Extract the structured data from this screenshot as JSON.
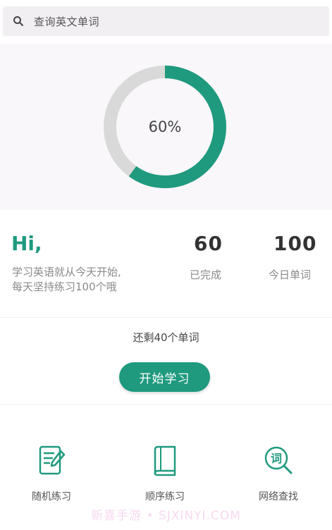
{
  "search": {
    "placeholder": "查询英文单词",
    "icon": "search-icon"
  },
  "progress": {
    "percent_label": "60%",
    "value": 0.6,
    "track_color": "#d9d9d9",
    "fill_color": "#1f9a7e"
  },
  "greeting": {
    "title": "Hi,",
    "line1": "学习英语就从今天开始,",
    "line2": "每天坚持练习100个哦"
  },
  "stats": {
    "completed": {
      "value": "60",
      "label": "已完成"
    },
    "daily": {
      "value": "100",
      "label": "今日单词"
    }
  },
  "remaining_text": "还剩40个单词",
  "start_button": "开始学习",
  "features": [
    {
      "label": "随机练习",
      "icon": "notepad-icon"
    },
    {
      "label": "顺序练习",
      "icon": "book-icon"
    },
    {
      "label": "网络查找",
      "icon": "word-search-icon"
    }
  ],
  "watermark": "新喜手游 • SJXINYI.COM",
  "colors": {
    "accent": "#1f9a7e"
  }
}
